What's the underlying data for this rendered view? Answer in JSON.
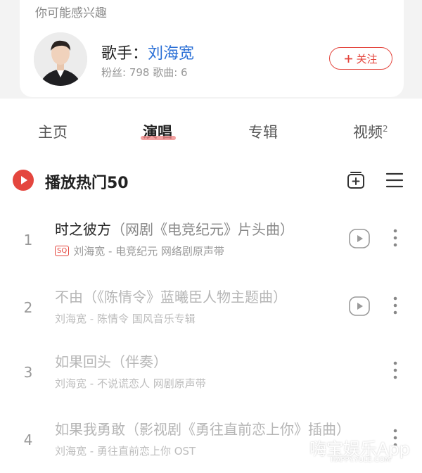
{
  "recommend": {
    "heading": "你可能感兴趣",
    "artist_prefix": "歌手：",
    "artist_name": "刘海宽",
    "stats": "粉丝: 798  歌曲: 6",
    "follow_label": "关注"
  },
  "tabs": [
    {
      "label": "主页",
      "active": false
    },
    {
      "label": "演唱",
      "active": true
    },
    {
      "label": "专辑",
      "active": false
    },
    {
      "label": "视频",
      "badge": "2",
      "active": false
    }
  ],
  "section": {
    "title": "播放热门50"
  },
  "songs": [
    {
      "num": "1",
      "title": "时之彼方",
      "subtitle": "（网剧《电竞纪元》片头曲）",
      "sq": "SQ",
      "meta": "刘海宽 - 电竞纪元 网络剧原声带",
      "mv": true,
      "dim": false
    },
    {
      "num": "2",
      "title": "不由",
      "subtitle": "（《陈情令》蓝曦臣人物主题曲）",
      "sq": "",
      "meta": "刘海宽 - 陈情令  国风音乐专辑",
      "mv": true,
      "dim": true
    },
    {
      "num": "3",
      "title": "如果回头",
      "subtitle": "（伴奏）",
      "sq": "",
      "meta": "刘海宽 - 不说谎恋人 网剧原声带",
      "mv": false,
      "dim": true
    },
    {
      "num": "4",
      "title": "如果我勇敢",
      "subtitle": "（影视剧《勇往直前恋上你》插曲）",
      "sq": "",
      "meta": "刘海宽 - 勇往直前恋上你 OST",
      "mv": false,
      "dim": true
    }
  ],
  "watermark": {
    "text": "嗨宝娱乐App",
    "sub": "HAPPY.YULE.COM"
  },
  "colors": {
    "accent": "#e4463e",
    "link": "#2a6fd6"
  }
}
